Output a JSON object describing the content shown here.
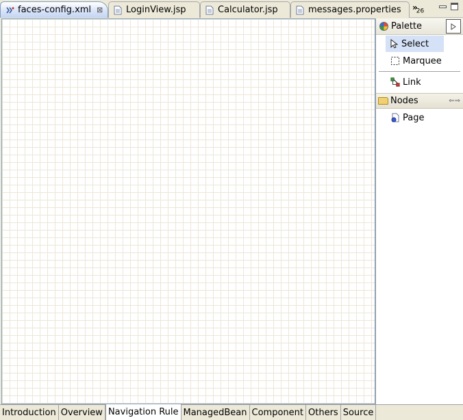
{
  "editor_tabs": [
    {
      "label": "faces-config.xml",
      "icon": "faces-config-icon",
      "active": true,
      "close": "⊠"
    },
    {
      "label": "LoginView.jsp",
      "icon": "jsp-file-icon"
    },
    {
      "label": "Calculator.jsp",
      "icon": "jsp-file-icon"
    },
    {
      "label": "messages.properties",
      "icon": "properties-file-icon"
    }
  ],
  "overflow": {
    "chevron": "»",
    "count": "26"
  },
  "palette": {
    "title": "Palette",
    "tools": [
      {
        "label": "Select",
        "icon": "select-arrow-icon",
        "selected": true
      },
      {
        "label": "Marquee",
        "icon": "marquee-icon"
      }
    ],
    "link": {
      "label": "Link",
      "icon": "link-icon"
    },
    "drawer": {
      "label": "Nodes",
      "icon": "folder-open-icon"
    },
    "nodes": [
      {
        "label": "Page",
        "icon": "page-node-icon"
      }
    ]
  },
  "page_tabs": [
    {
      "label": "Introduction"
    },
    {
      "label": "Overview"
    },
    {
      "label": "Navigation Rule",
      "active": true
    },
    {
      "label": "ManagedBean"
    },
    {
      "label": "Component"
    },
    {
      "label": "Others"
    },
    {
      "label": "Source"
    }
  ]
}
